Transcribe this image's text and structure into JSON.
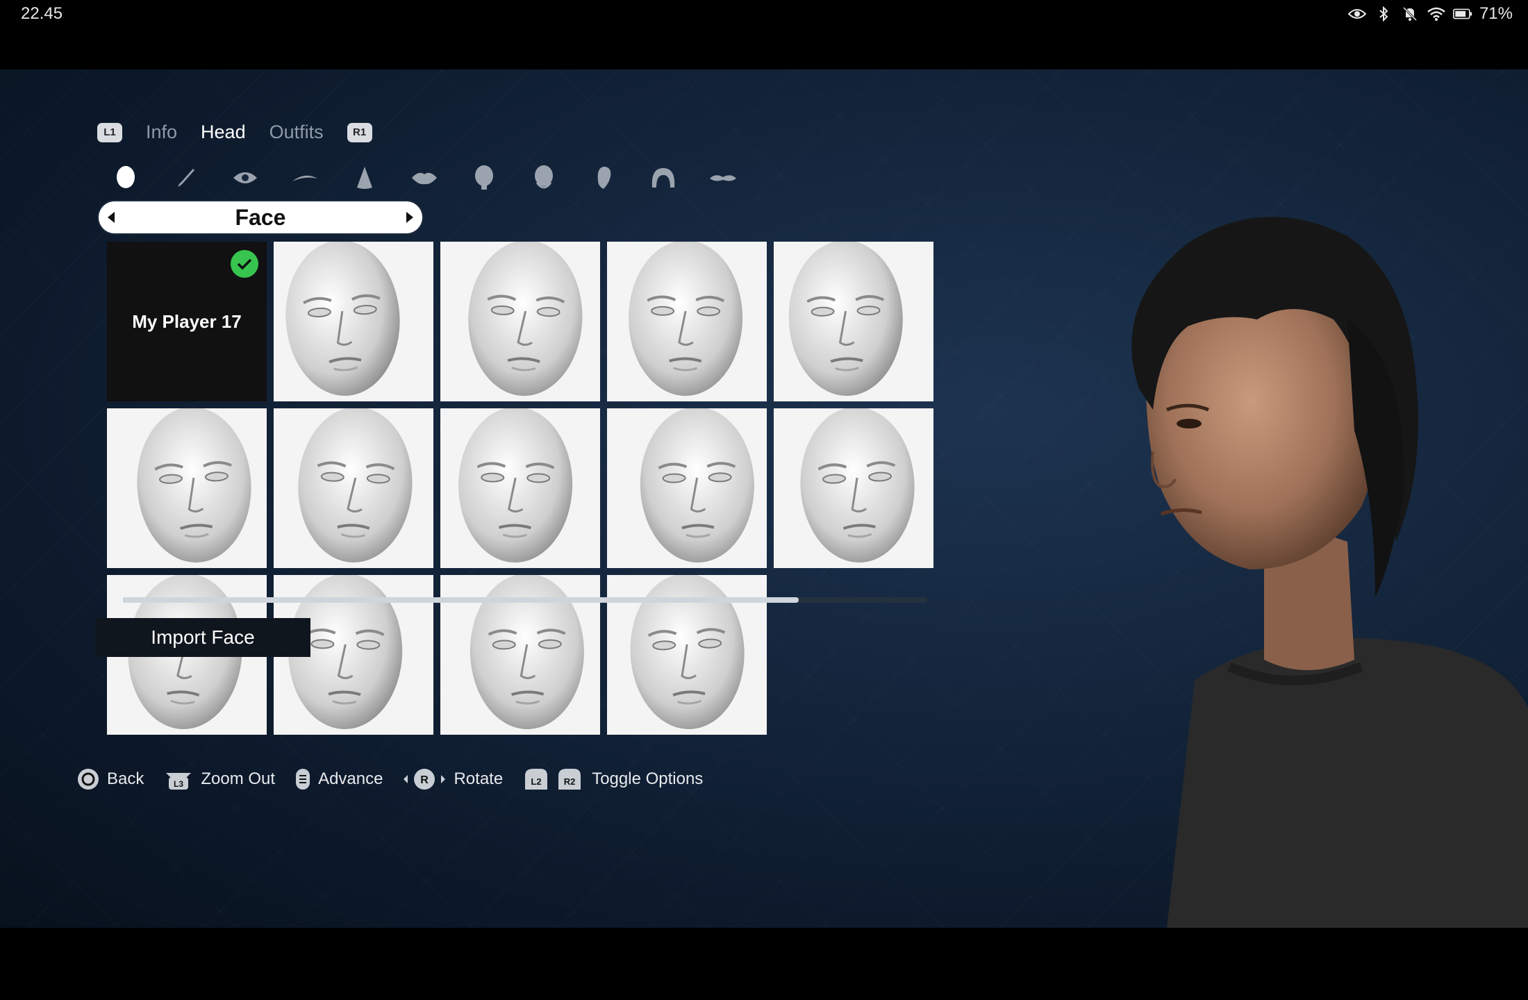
{
  "status": {
    "time": "22.45",
    "battery_percent": "71%",
    "icons": [
      "eye-icon",
      "bluetooth-icon",
      "mute-icon",
      "wifi-icon",
      "battery-icon"
    ]
  },
  "tabs": {
    "left_button": "L1",
    "right_button": "R1",
    "items": [
      {
        "label": "Info",
        "active": false
      },
      {
        "label": "Head",
        "active": true
      },
      {
        "label": "Outfits",
        "active": false
      }
    ]
  },
  "category_icons": [
    "face-shape-icon",
    "skin-brush-icon",
    "eye-icon",
    "eyebrow-icon",
    "nose-icon",
    "lips-icon",
    "head-shape-icon",
    "jaw-icon",
    "ear-icon",
    "hair-icon",
    "mustache-icon"
  ],
  "face_selector": {
    "label": "Face"
  },
  "faces": {
    "custom_name": "My Player 17",
    "preset_count": 13
  },
  "scroll": {
    "position_fraction": 0.84
  },
  "import_button": "Import Face",
  "hints": [
    {
      "icon": "circle-button-icon",
      "label": "Back"
    },
    {
      "icon": "l3-stick-icon",
      "label": "Zoom Out"
    },
    {
      "icon": "options-button-icon",
      "label": "Advance"
    },
    {
      "icon": "right-stick-icon",
      "label": "Rotate"
    },
    {
      "icon": "l2-r2-icon",
      "label": "Toggle Options"
    }
  ],
  "hint_button_labels": {
    "l3": "L3",
    "r": "R",
    "l2": "L2",
    "r2": "R2"
  },
  "colors": {
    "check": "#37c44f",
    "background": "#15273e"
  }
}
